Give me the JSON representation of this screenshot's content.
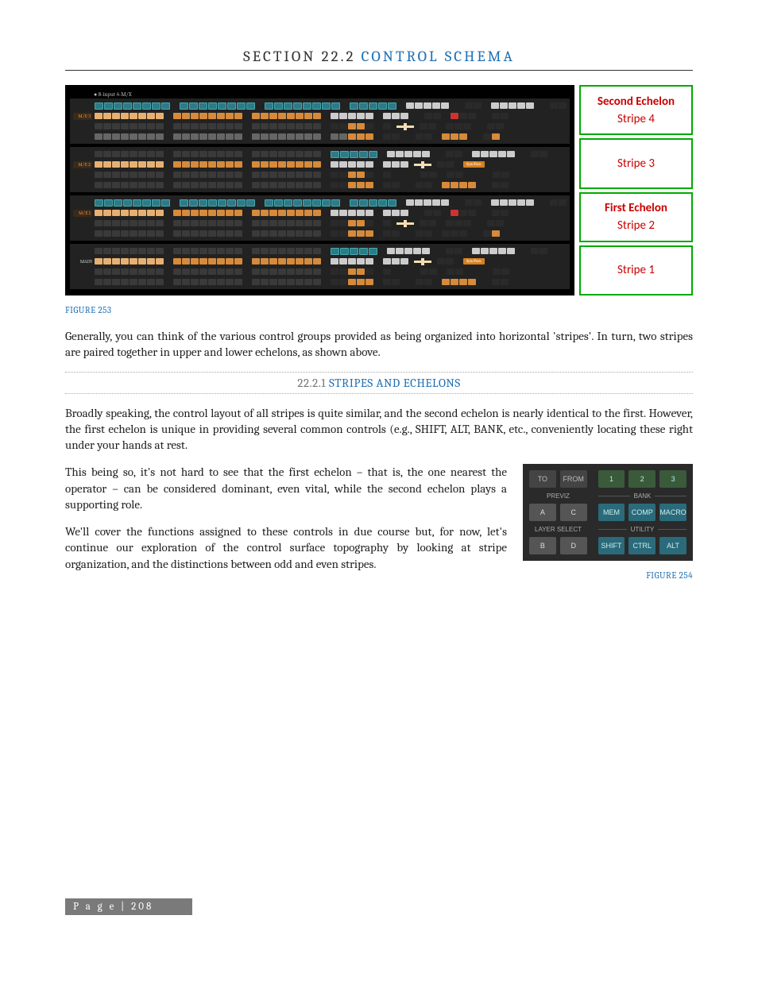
{
  "section": {
    "number": "SECTION 22.2",
    "title": "CONTROL SCHEMA"
  },
  "figure253": {
    "caption": "FIGURE 253",
    "echelons": [
      {
        "echelon": "Second Echelon",
        "stripe": "Stripe 4"
      },
      {
        "echelon": "",
        "stripe": "Stripe 3"
      },
      {
        "echelon": "First Echelon",
        "stripe": "Stripe 2"
      },
      {
        "echelon": "",
        "stripe": "Stripe 1"
      }
    ],
    "row_labels": {
      "mv1": "M/E 1",
      "mv2": "M/E 2",
      "mv3": "M/E 3",
      "main": "MAIN"
    }
  },
  "para1": "Generally, you can think of the various control groups provided as being organized into horizontal 'stripes'. In turn, two stripes are paired together in upper and lower echelons, as shown above.",
  "subsection": {
    "number": "22.2.1",
    "title": "STRIPES AND ECHELONS"
  },
  "para2": "Broadly speaking, the control layout of  all stripes is quite similar, and the second echelon is nearly identical to the first.  However, the first echelon is unique in providing several common controls (e.g., SHIFT, ALT, BANK, etc., conveniently locating these right under your hands at rest.",
  "para3": "This being so, it's not hard to see that the first echelon – that is, the one nearest the operator – can be considered dominant, even vital, while the second echelon plays a supporting role.",
  "para4": "We'll cover the functions assigned to these controls in due course but, for now, let's continue our exploration of the control surface topography by looking at stripe organization, and the distinctions between odd and even stripes.",
  "figure254": {
    "caption": "FIGURE 254",
    "buttons": {
      "to": "TO",
      "from": "FROM",
      "n1": "1",
      "n2": "2",
      "n3": "3",
      "previz": "PREVIZ",
      "bank": "BANK",
      "a": "A",
      "c": "C",
      "mem": "MEM",
      "comp": "COMP",
      "macro": "MACRO",
      "layer_select": "LAYER SELECT",
      "utility": "UTILITY",
      "b": "B",
      "d": "D",
      "shift": "SHIFT",
      "ctrl": "CTRL",
      "alt": "ALT"
    }
  },
  "footer": {
    "label": "P a g e  |",
    "number": "208"
  }
}
